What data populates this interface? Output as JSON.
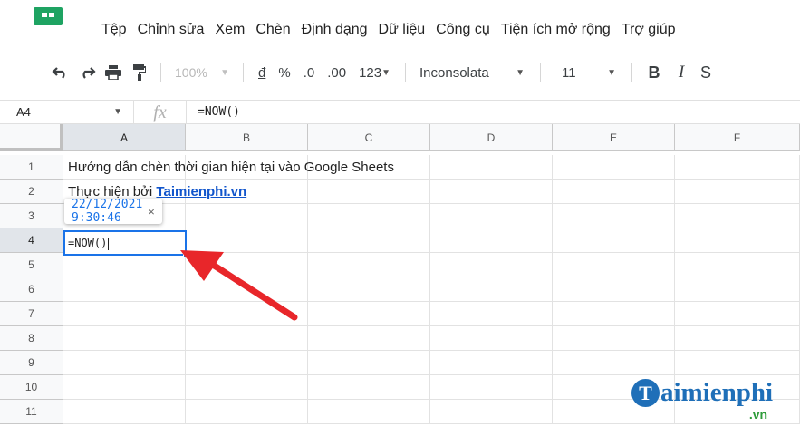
{
  "menu": [
    "Tệp",
    "Chỉnh sửa",
    "Xem",
    "Chèn",
    "Định dạng",
    "Dữ liệu",
    "Công cụ",
    "Tiện ích mở rộng",
    "Trợ giúp"
  ],
  "toolbar": {
    "undo_icon": "undo-icon",
    "redo_icon": "redo-icon",
    "print_icon": "print-icon",
    "paint_format_icon": "paint-format-icon",
    "zoom": "100%",
    "currency": "đ",
    "percent": "%",
    "decrease_decimal": ".0",
    "increase_decimal": ".00",
    "more_formats": "123",
    "font_name": "Inconsolata",
    "font_size": "11",
    "bold": "B",
    "italic": "I",
    "strikethrough": "S"
  },
  "formula_bar": {
    "name_box": "A4",
    "fx": "fx",
    "formula": "=NOW()"
  },
  "columns": [
    "A",
    "B",
    "C",
    "D",
    "E",
    "F"
  ],
  "rows": [
    "1",
    "2",
    "3",
    "4",
    "5",
    "6",
    "7",
    "8",
    "9",
    "10",
    "11"
  ],
  "cells": {
    "A1": "Hướng dẫn chèn thời gian hiện tại vào Google Sheets",
    "A2_prefix": "Thực hiện bởi ",
    "A2_link": "Taimienphi.vn",
    "A4": "=NOW()"
  },
  "preview": {
    "value": "22/12/2021 9:30:46",
    "close": "×"
  },
  "watermark": {
    "badge": "T",
    "text": "aimienphi",
    "sub": ".vn"
  },
  "colors": {
    "accent": "#1a73e8",
    "link": "#1155cc",
    "arrow": "#e8262a",
    "logo": "#1ea362"
  }
}
